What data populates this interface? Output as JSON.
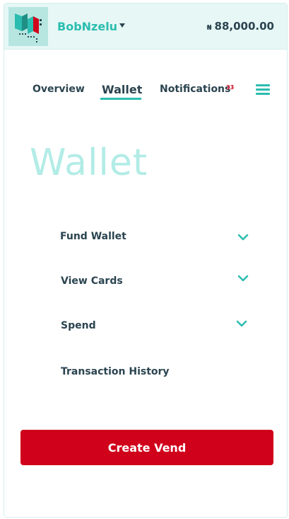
{
  "header": {
    "username": "BobNzelu",
    "balance_currency": "₦",
    "balance_amount": "88,000.00"
  },
  "nav": {
    "items": [
      {
        "label": "Overview"
      },
      {
        "label": "Wallet"
      },
      {
        "label": "Notifications"
      }
    ],
    "notification_count": "33",
    "active": "Wallet"
  },
  "main": {
    "title": "Wallet",
    "menu": [
      {
        "label": "Fund Wallet",
        "expandable": true
      },
      {
        "label": "View Cards",
        "expandable": true
      },
      {
        "label": "Spend",
        "expandable": true
      },
      {
        "label": "Transaction History",
        "expandable": false
      }
    ]
  },
  "cta": {
    "label": "Create Vend"
  },
  "icons": {
    "logo": "brand-logo",
    "dropdown": "caret-down-icon",
    "menu": "hamburger-menu-icon",
    "expand": "chevron-down-icon"
  },
  "colors": {
    "accent": "#2bbdb0",
    "text_dark": "#2b4450",
    "header_bg": "#e6f7f5",
    "title_light": "#b2ece6",
    "badge_red": "#d0021b",
    "cta_red": "#d0021b"
  }
}
